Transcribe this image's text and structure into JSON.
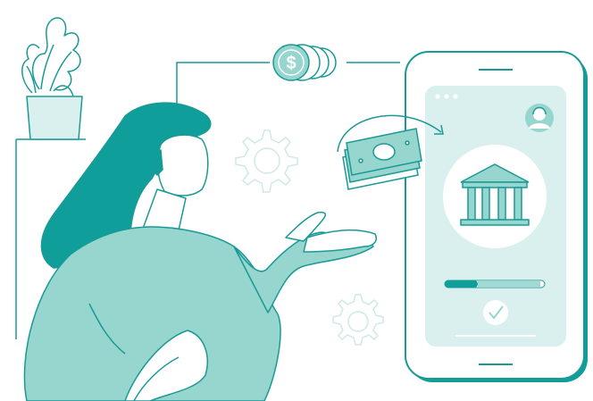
{
  "illustration": {
    "colors": {
      "teal_dark": "#0f9e9a",
      "teal_light": "#97d5cf",
      "teal_pale": "#d9f0ee",
      "line": "#1a9a95",
      "white": "#ffffff"
    },
    "icons": [
      "plant-icon",
      "coin-stack-icon",
      "gear-icon",
      "banknote-icon",
      "bank-icon",
      "checkmark-icon",
      "user-avatar-icon"
    ],
    "phone": {
      "progress_fraction": 0.33
    }
  }
}
